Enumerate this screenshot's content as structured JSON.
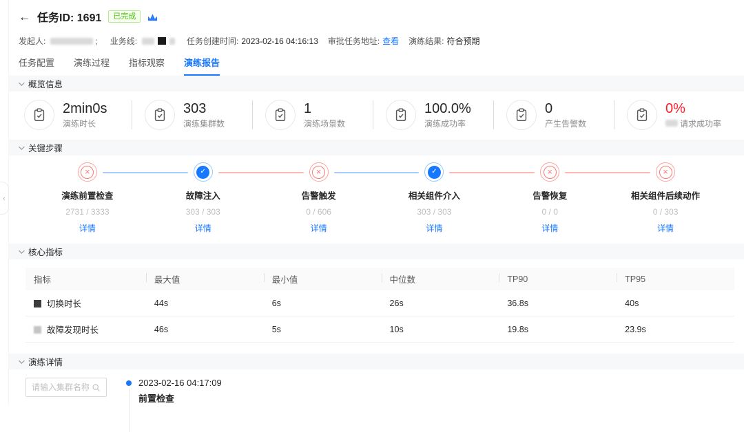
{
  "header": {
    "back_arrow": "←",
    "title": "任务ID: 1691",
    "status": "已完成"
  },
  "info": {
    "initiator_label": "发起人:",
    "separator": ";",
    "busline_label": "业务线:",
    "created_label": "任务创建时间:",
    "created_value": "2023-02-16 04:16:13",
    "approval_label": "审批任务地址:",
    "approval_link": "查看",
    "result_label": "演练结果:",
    "result_value": "符合预期"
  },
  "tabs": [
    {
      "label": "任务配置"
    },
    {
      "label": "演练过程"
    },
    {
      "label": "指标观察"
    },
    {
      "label": "演练报告"
    }
  ],
  "overview": {
    "title": "概览信息",
    "icon": "clipboard-check-icon",
    "stats": [
      {
        "value": "2min0s",
        "label": "演练时长"
      },
      {
        "value": "303",
        "label": "演练集群数"
      },
      {
        "value": "1",
        "label": "演练场景数"
      },
      {
        "value": "100.0%",
        "label": "演练成功率"
      },
      {
        "value": "0",
        "label": "产生告警数"
      },
      {
        "value": "0%",
        "label": "请求成功率",
        "value_color": "#f5222d",
        "label_prefix_redacted": true
      }
    ]
  },
  "key_steps": {
    "title": "关键步骤",
    "detail_link": "详情",
    "items": [
      {
        "name": "演练前置检查",
        "count": "2731 / 3333",
        "status": "fail"
      },
      {
        "name": "故障注入",
        "count": "303 / 303",
        "status": "pass"
      },
      {
        "name": "告警触发",
        "count": "0 / 606",
        "status": "fail"
      },
      {
        "name": "相关组件介入",
        "count": "303 / 303",
        "status": "pass"
      },
      {
        "name": "告警恢复",
        "count": "0 / 0",
        "status": "fail"
      },
      {
        "name": "相关组件后续动作",
        "count": "0 / 303",
        "status": "fail"
      }
    ]
  },
  "core_metrics": {
    "title": "核心指标",
    "columns": [
      "指标",
      "最大值",
      "最小值",
      "中位数",
      "TP90",
      "TP95"
    ],
    "rows": [
      {
        "name": "切换时长",
        "values": [
          "44s",
          "6s",
          "26s",
          "36.8s",
          "40s"
        ]
      },
      {
        "name": "故障发现时长",
        "values": [
          "46s",
          "5s",
          "10s",
          "19.8s",
          "23.9s"
        ]
      }
    ]
  },
  "details": {
    "title": "演练详情",
    "search_placeholder": "请输入集群名称",
    "timeline": [
      {
        "time": "2023-02-16 04:17:09",
        "title": "前置检查"
      }
    ]
  },
  "colors": {
    "accent_blue": "#1677ff",
    "danger_red": "#f5222d",
    "success_green": "#52c41a",
    "fail_soft": "#ff7875",
    "pass_soft": "#91caff",
    "section_bar_bg": "#f7f8fa",
    "table_header_bg": "#fafafa"
  }
}
